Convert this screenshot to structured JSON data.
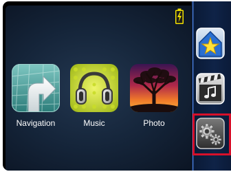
{
  "status": {
    "battery_icon": "battery-charging-icon",
    "battery_color": "#f2e000"
  },
  "apps": [
    {
      "label": "Navigation",
      "icon": "navigation-icon"
    },
    {
      "label": "Music",
      "icon": "headphones-icon"
    },
    {
      "label": "Photo",
      "icon": "tree-sunset-icon"
    }
  ],
  "side_menu": [
    {
      "icon": "favorites-star-icon"
    },
    {
      "icon": "media-clapperboard-icon"
    },
    {
      "icon": "settings-gears-icon",
      "selected": true
    }
  ],
  "colors": {
    "selection": "#d8102a",
    "panel_border": "#2c4f8e"
  }
}
